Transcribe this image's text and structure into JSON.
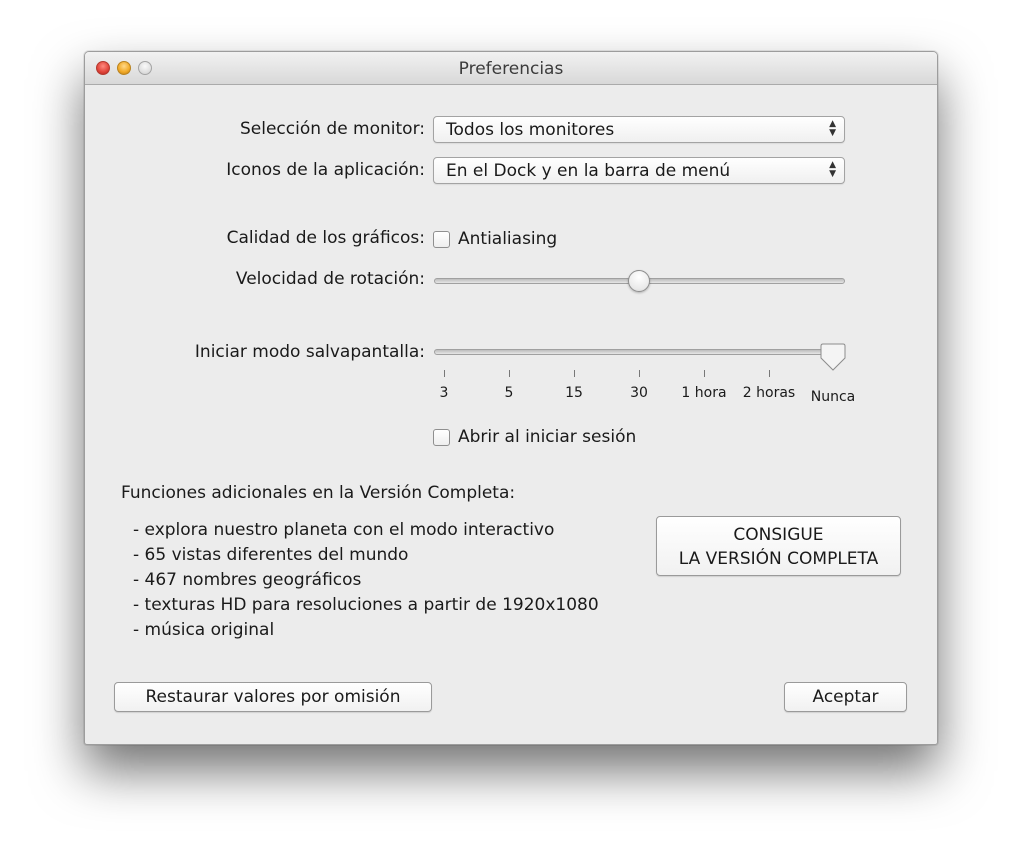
{
  "window": {
    "title": "Preferencias"
  },
  "monitor": {
    "label": "Selección de monitor:",
    "value": "Todos los monitores"
  },
  "icons": {
    "label": "Iconos de la aplicación:",
    "value": "En el Dock y en la barra de menú"
  },
  "quality": {
    "label": "Calidad de los gráficos:",
    "checkbox_label": "Antialiasing",
    "checked": false
  },
  "rotation": {
    "label": "Velocidad de rotación:",
    "value_fraction": 0.5
  },
  "screensaver": {
    "label": "Iniciar modo salvapantalla:",
    "ticks": [
      "3",
      "5",
      "15",
      "30",
      "1 hora",
      "2 horas",
      "Nunca"
    ],
    "selected": "Nunca"
  },
  "login": {
    "checkbox_label": "Abrir al iniciar sesión",
    "checked": false
  },
  "full_version": {
    "heading": "Funciones adicionales en la Versión Completa:",
    "features": [
      "- explora nuestro planeta con el modo interactivo",
      "- 65 vistas diferentes del mundo",
      "- 467 nombres geográficos",
      "- texturas HD para resoluciones a partir de 1920x1080",
      "- música original"
    ],
    "button_line1": "CONSIGUE",
    "button_line2": "LA VERSIÓN COMPLETA"
  },
  "buttons": {
    "restore": "Restaurar valores por omisión",
    "accept": "Aceptar"
  }
}
